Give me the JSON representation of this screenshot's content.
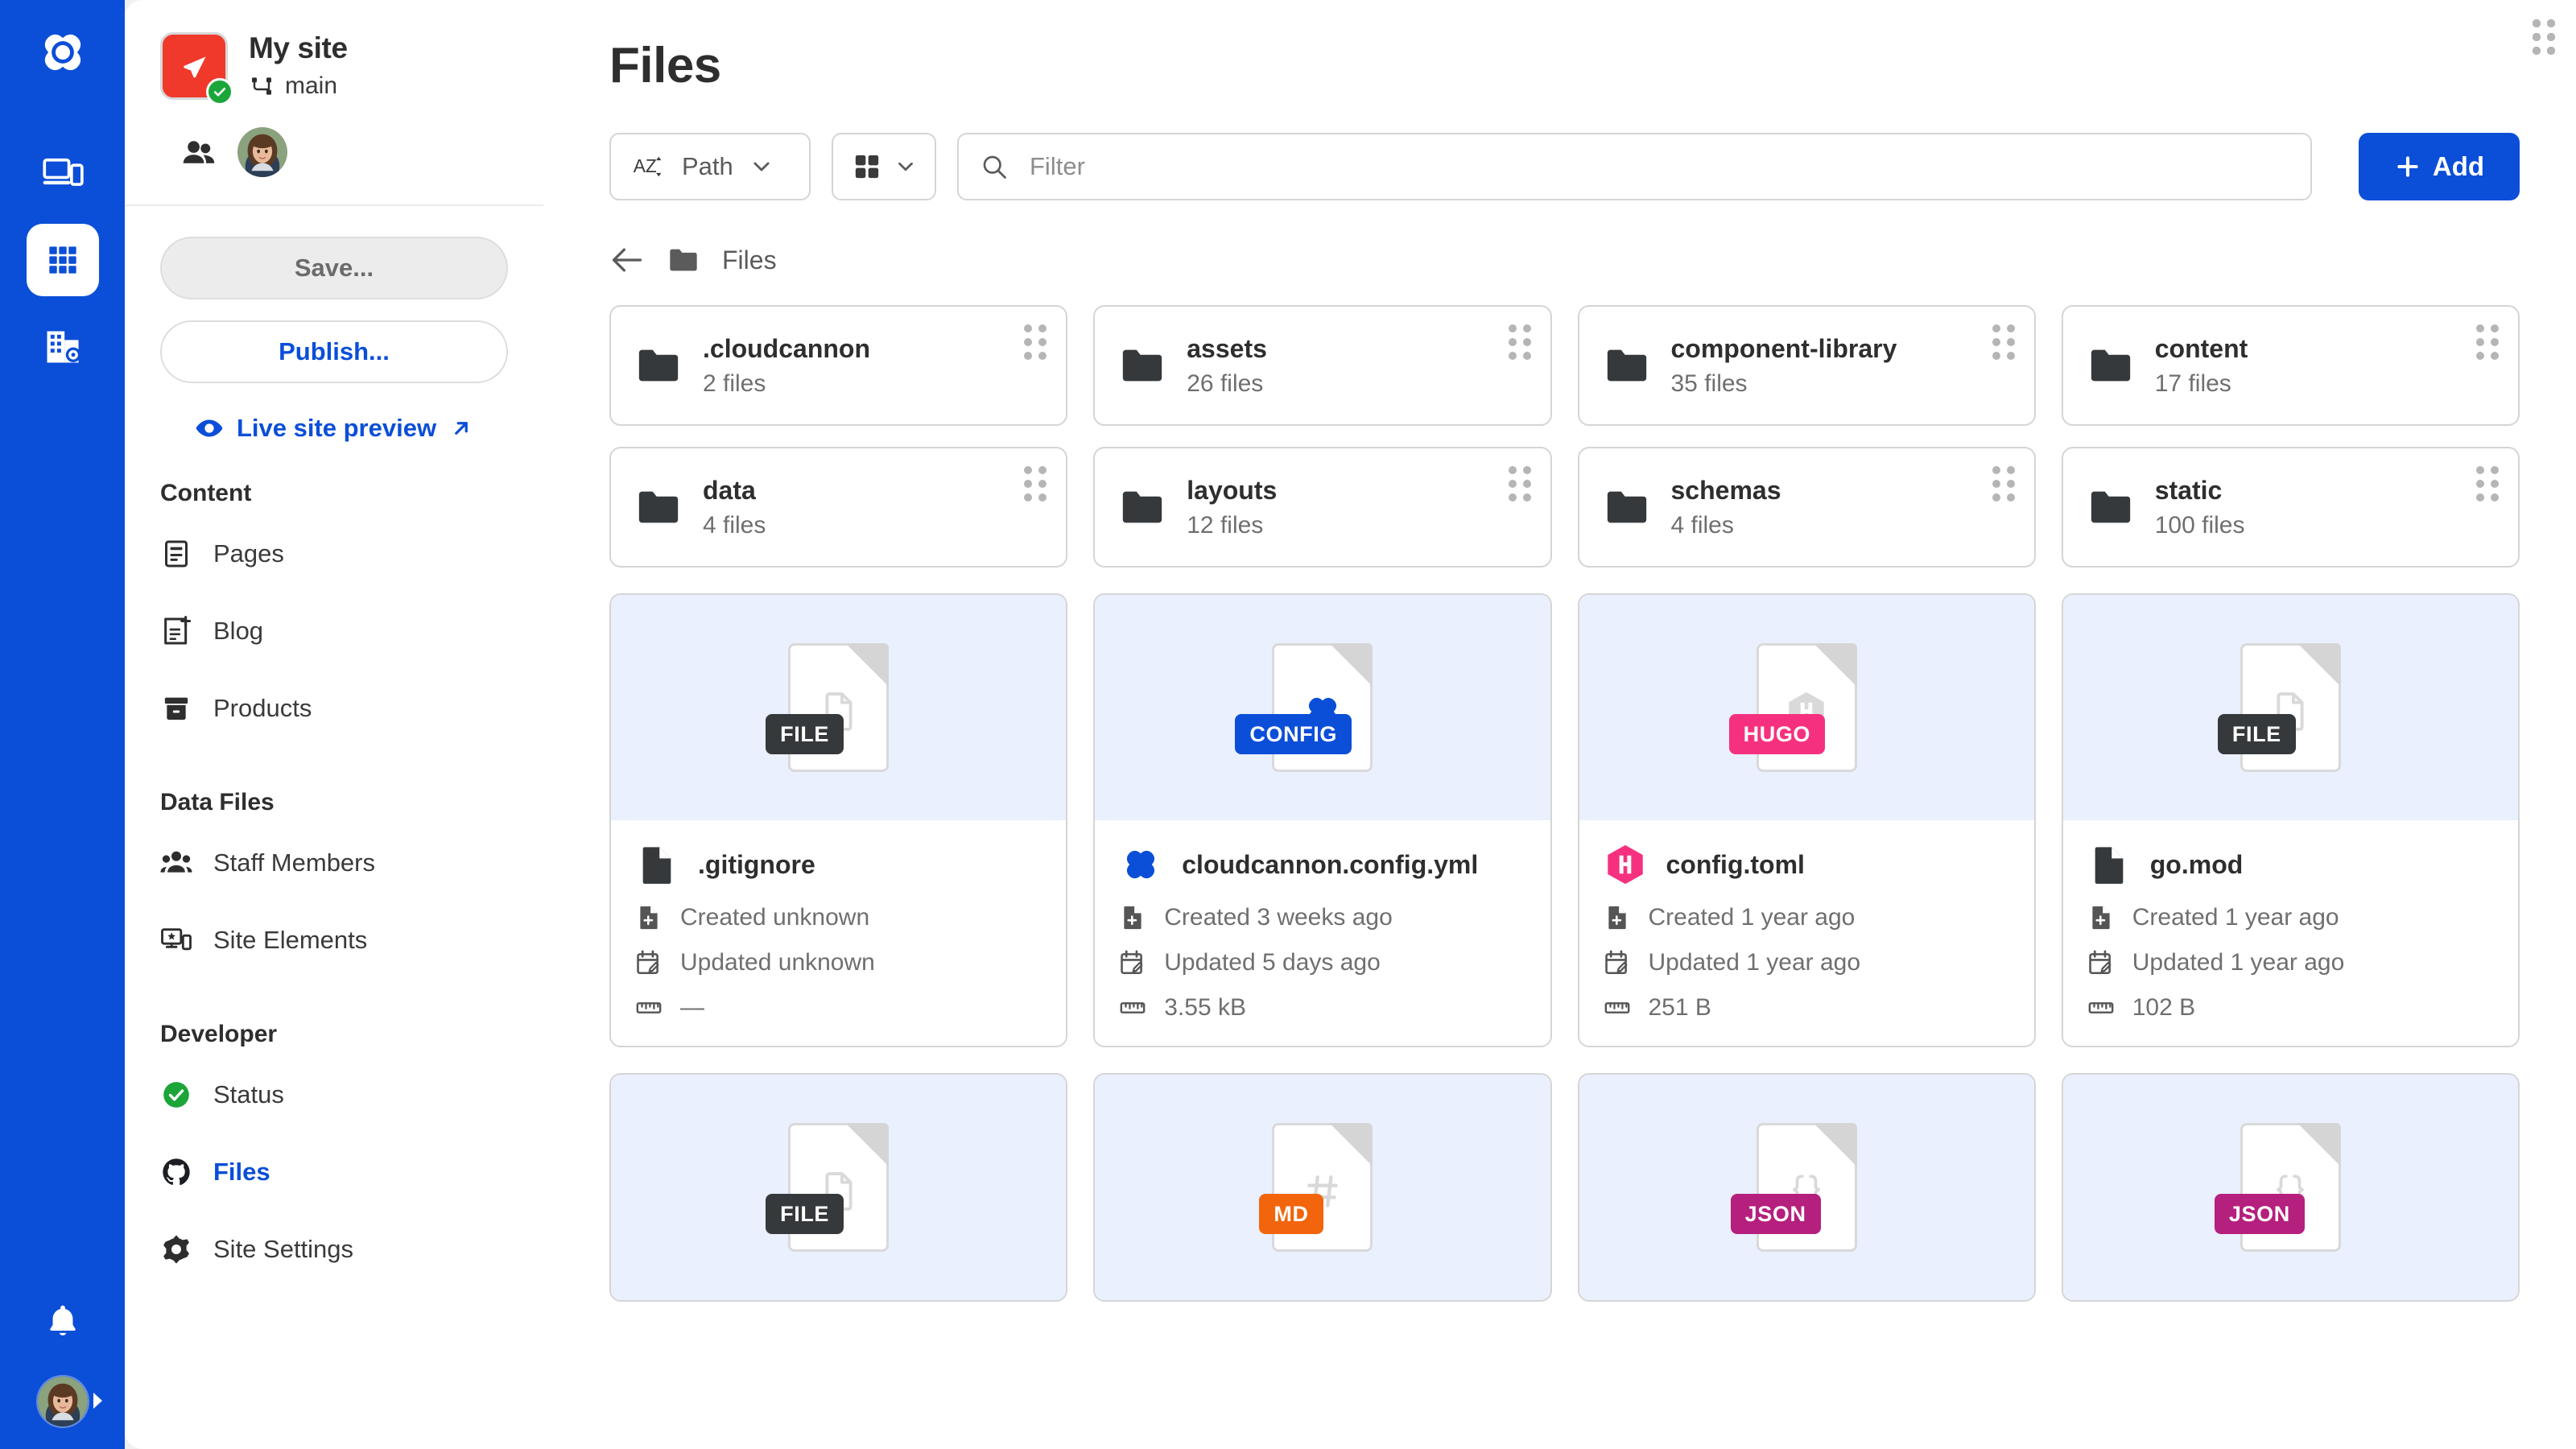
{
  "rail": {
    "logo_icon": "cloudcannon-logo-icon",
    "items": [
      {
        "icon": "devices-icon",
        "name": "devices",
        "active": false
      },
      {
        "icon": "grid-apps-icon",
        "name": "apps-grid",
        "active": true
      },
      {
        "icon": "organisation-settings-icon",
        "name": "organisation-settings",
        "active": false
      }
    ],
    "notifications_icon": "bell-icon",
    "avatar_alt": "User avatar"
  },
  "sidebar": {
    "site": {
      "name": "My site",
      "branch": "main",
      "branch_icon": "branch-icon",
      "status_badge": "check-icon",
      "thumb_color": "#f0392b",
      "badge_color": "#1ca63a"
    },
    "members": {
      "icon": "people-icon",
      "avatar_alt": "Member avatar"
    },
    "actions": {
      "save_label": "Save...",
      "publish_label": "Publish...",
      "live_preview_label": "Live site preview",
      "live_preview_icon": "eye-icon",
      "external_link_icon": "arrow-up-right-icon"
    },
    "groups": [
      {
        "title": "Content",
        "items": [
          {
            "label": "Pages",
            "icon": "page-icon",
            "active": false
          },
          {
            "label": "Blog",
            "icon": "blog-post-icon",
            "active": false
          },
          {
            "label": "Products",
            "icon": "archive-box-icon",
            "active": false
          }
        ]
      },
      {
        "title": "Data Files",
        "items": [
          {
            "label": "Staff Members",
            "icon": "people-group-icon",
            "active": false
          },
          {
            "label": "Site Elements",
            "icon": "site-elements-icon",
            "active": false
          }
        ]
      },
      {
        "title": "Developer",
        "items": [
          {
            "label": "Status",
            "icon": "status-check-icon",
            "active": false
          },
          {
            "label": "Files",
            "icon": "github-icon",
            "active": true
          },
          {
            "label": "Site Settings",
            "icon": "gear-icon",
            "active": false
          }
        ]
      }
    ]
  },
  "main": {
    "title": "Files",
    "toolbar": {
      "sort_icon": "sort-az-icon",
      "sort_label": "Path",
      "sort_chevron": "chevron-down-icon",
      "view_icon": "grid-view-icon",
      "view_chevron": "chevron-down-icon",
      "search_icon": "search-icon",
      "filter_value": "",
      "filter_placeholder": "Filter",
      "add_label": "Add",
      "add_icon": "plus-icon",
      "accent_color": "#0b4ed8"
    },
    "breadcrumb": {
      "back_icon": "arrow-left-icon",
      "folder_icon": "folder-icon",
      "label": "Files"
    },
    "folders": [
      {
        "name": ".cloudcannon",
        "count": "2 files"
      },
      {
        "name": "assets",
        "count": "26 files"
      },
      {
        "name": "component-library",
        "count": "35 files"
      },
      {
        "name": "content",
        "count": "17 files"
      },
      {
        "name": "data",
        "count": "4 files"
      },
      {
        "name": "layouts",
        "count": "12 files"
      },
      {
        "name": "schemas",
        "count": "4 files"
      },
      {
        "name": "static",
        "count": "100 files"
      }
    ],
    "files": [
      {
        "name": ".gitignore",
        "badge": "FILE",
        "badge_color": "#36393b",
        "glyph": "page-outline-icon",
        "icon": "file-dark-icon",
        "icon_color": "#36393b",
        "created": "Created unknown",
        "updated": "Updated unknown",
        "size": "—"
      },
      {
        "name": "cloudcannon.config.yml",
        "badge": "CONFIG",
        "badge_color": "#0b4ed8",
        "glyph": "cloudcannon-logo-icon",
        "icon": "cloudcannon-logo-icon",
        "icon_color": "#0b4ed8",
        "created": "Created 3 weeks ago",
        "updated": "Updated 5 days ago",
        "size": "3.55 kB"
      },
      {
        "name": "config.toml",
        "badge": "HUGO",
        "badge_color": "#f5317f",
        "glyph": "hugo-hex-icon",
        "icon": "hugo-hex-icon",
        "icon_color": "#f5317f",
        "created": "Created 1 year ago",
        "updated": "Updated 1 year ago",
        "size": "251 B"
      },
      {
        "name": "go.mod",
        "badge": "FILE",
        "badge_color": "#36393b",
        "glyph": "page-outline-icon",
        "icon": "file-dark-icon",
        "icon_color": "#36393b",
        "created": "Created 1 year ago",
        "updated": "Updated 1 year ago",
        "size": "102 B"
      }
    ],
    "files_partial": [
      {
        "badge": "FILE",
        "badge_color": "#36393b",
        "glyph": "page-outline-icon"
      },
      {
        "badge": "MD",
        "badge_color": "#f2650c",
        "glyph": "hash-icon"
      },
      {
        "badge": "JSON",
        "badge_color": "#b51f7e",
        "glyph": "braces-icon"
      },
      {
        "badge": "JSON",
        "badge_color": "#b51f7e",
        "glyph": "braces-icon"
      }
    ],
    "meta_icons": {
      "created": "file-plus-icon",
      "updated": "calendar-edit-icon",
      "size": "ruler-icon"
    }
  }
}
